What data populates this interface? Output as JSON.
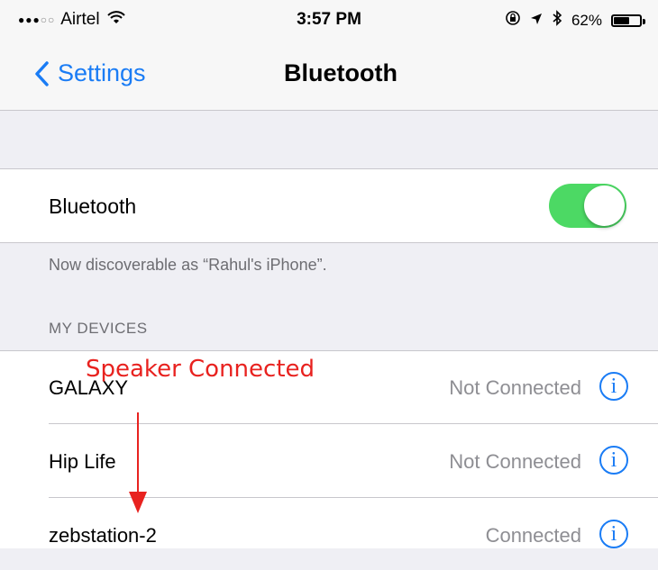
{
  "status_bar": {
    "carrier": "Airtel",
    "time": "3:57 PM",
    "battery": "62%",
    "battery_level": 0.62
  },
  "nav": {
    "back_label": "Settings",
    "title": "Bluetooth"
  },
  "bluetooth": {
    "label": "Bluetooth",
    "enabled": true,
    "discoverable_text": "Now discoverable as “Rahul's iPhone”."
  },
  "devices": {
    "header": "MY DEVICES",
    "items": [
      {
        "name": "GALAXY",
        "status": "Not Connected"
      },
      {
        "name": "Hip Life",
        "status": "Not Connected"
      },
      {
        "name": "zebstation-2",
        "status": "Connected"
      }
    ]
  },
  "annotation": {
    "text": "Speaker Connected",
    "color": "#e8221f"
  },
  "colors": {
    "accent": "#1a7cf5",
    "toggle_on": "#4cd964"
  }
}
